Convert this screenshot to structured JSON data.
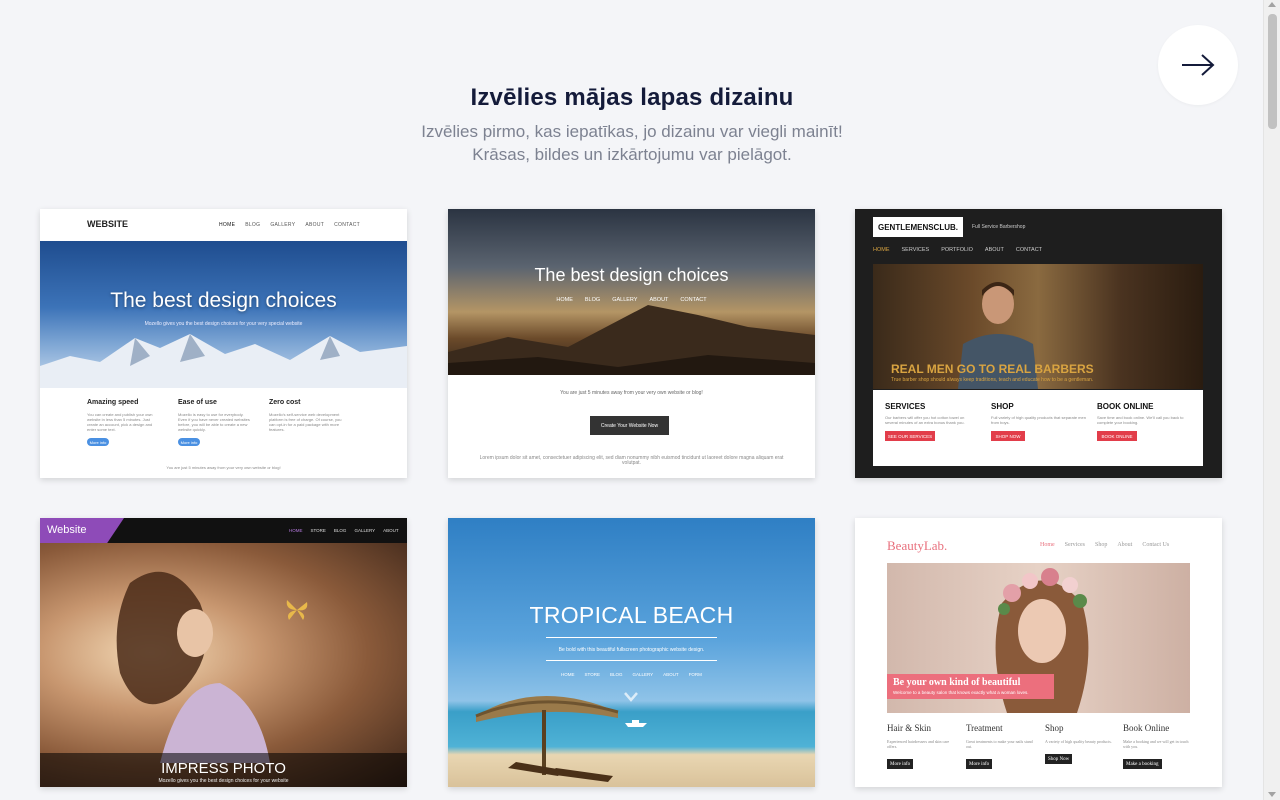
{
  "header": {
    "title": "Izvēlies mājas lapas dizainu",
    "subtitle_line1": "Izvēlies pirmo, kas iepatīkas, jo dizainu var viegli mainīt!",
    "subtitle_line2": "Krāsas, bildes un izkārtojumu var pielāgot."
  },
  "next_button": {
    "icon": "arrow-right-icon"
  },
  "templates": {
    "t1": {
      "logo": "WEBSITE",
      "nav": [
        "HOME",
        "BLOG",
        "GALLERY",
        "ABOUT",
        "CONTACT"
      ],
      "hero_title": "The best design choices",
      "hero_sub": "Mozello gives you the best design choices for your very special website",
      "features": [
        {
          "title": "Amazing speed",
          "text": "You can create and publish your own website in less than 5 minutes. Just create an account, pick a design and enter some text.",
          "btn": "More info"
        },
        {
          "title": "Ease of use",
          "text": "Mozello is easy to use for everybody. Even if you have never created websites before, you will be able to create a new website quickly.",
          "btn": "More info"
        },
        {
          "title": "Zero cost",
          "text": "Mozello's self-service web development platform is free of charge. Of course, you can opt-in for a paid package with more features."
        }
      ],
      "footer": "You are just 5 minutes away from your very own website or blog!"
    },
    "t2": {
      "hero_title": "The best design choices",
      "nav": [
        "HOME",
        "BLOG",
        "GALLERY",
        "ABOUT",
        "CONTACT"
      ],
      "tagline": "You are just 5 minutes away from your very own website or blog!",
      "cta": "Create Your Website Now",
      "lorem": "Lorem ipsum dolor sit amet, consectetuer adipiscing elit, sed diam nonummy nibh euismod tincidunt ut laoreet dolore magna aliquam erat volutpat."
    },
    "t3": {
      "logo": "GENTLEMENSCLUB.",
      "tag": "Full Service Barbershop",
      "nav": [
        "HOME",
        "SERVICES",
        "PORTFOLIO",
        "ABOUT",
        "CONTACT"
      ],
      "headline": "REAL MEN GO TO REAL BARBERS",
      "subline": "True barber shop should always keep traditions, teach and educate how to be a gentleman.",
      "cols": [
        {
          "title": "SERVICES",
          "text": "Our barbers will offer you hot cotton towel on several minutes of an extra bonus thank you.",
          "btn": "SEE OUR SERVICES"
        },
        {
          "title": "SHOP",
          "text": "Full variety of high quality products that separate men from boys.",
          "btn": "SHOP NOW"
        },
        {
          "title": "BOOK ONLINE",
          "text": "Save time and book online. We'll call you back to complete your booking.",
          "btn": "BOOK ONLINE"
        }
      ]
    },
    "t4": {
      "badge": "Website",
      "nav": [
        "HOME",
        "STORE",
        "BLOG",
        "GALLERY",
        "ABOUT"
      ],
      "title": "IMPRESS PHOTO",
      "sub": "Mozello gives you the best design choices for your website"
    },
    "t5": {
      "title": "TROPICAL BEACH",
      "sub": "Be bold with this beautiful fullscreen photographic website design.",
      "nav": [
        "HOME",
        "STORE",
        "BLOG",
        "GALLERY",
        "ABOUT",
        "FORM"
      ]
    },
    "t6": {
      "logo": "BeautyLab.",
      "nav": [
        "Home",
        "Services",
        "Shop",
        "About",
        "Contact Us"
      ],
      "banner_title": "Be your own kind of beautiful",
      "banner_sub": "Welcome to a beauty salon that knows exactly what a woman loves.",
      "cols": [
        {
          "title": "Hair & Skin",
          "text": "Experienced hairdressers and skin care offers.",
          "btn": "More info"
        },
        {
          "title": "Treatment",
          "text": "Great treatments to make your nails stand out.",
          "btn": "More info"
        },
        {
          "title": "Shop",
          "text": "A variety of high quality beauty products.",
          "btn": "Shop Now"
        },
        {
          "title": "Book Online",
          "text": "Make a booking and we will get in touch with you.",
          "btn": "Make a booking"
        }
      ]
    }
  },
  "colors": {
    "accent_red": "#e23d4a",
    "blue_button": "#4a90e2",
    "title_navy": "#141b3a",
    "beauty_pink": "#e8707d"
  }
}
